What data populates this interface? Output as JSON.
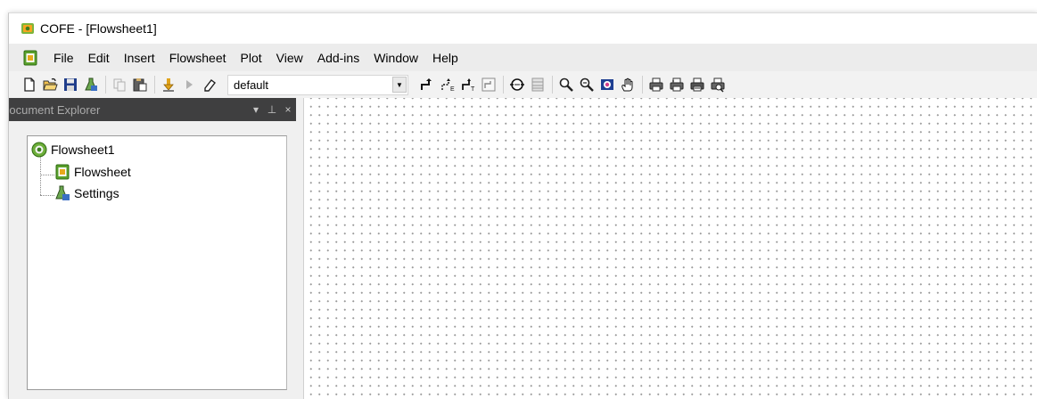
{
  "window": {
    "title": "COFE - [Flowsheet1]",
    "app_icon": "cofe-app-icon"
  },
  "menu": {
    "items": [
      "File",
      "Edit",
      "Insert",
      "Flowsheet",
      "Plot",
      "View",
      "Add-ins",
      "Window",
      "Help"
    ]
  },
  "toolbar": {
    "combo_value": "default",
    "buttons": [
      "new-icon",
      "open-icon",
      "save-icon",
      "flask-icon",
      "copy-icon",
      "paste-icon",
      "download-icon",
      "play-icon",
      "eraser-icon",
      "stream-icon",
      "stream-split-icon",
      "stream-merge-icon",
      "stream-box-icon",
      "unit-op-icon",
      "grid-icon",
      "zoom-in-icon",
      "zoom-out-icon",
      "zoom-window-icon",
      "pan-icon",
      "print-icon",
      "print-preview-icon",
      "print-setup-icon",
      "print-all-icon"
    ]
  },
  "explorer": {
    "title": "Document Explorer",
    "controls": {
      "dropdown": "▾",
      "pin": "⊥",
      "close": "×"
    },
    "tree": {
      "root": "Flowsheet1",
      "children": [
        "Flowsheet",
        "Settings"
      ]
    }
  },
  "colors": {
    "panel_header": "#3f3f40",
    "menubar": "#ececec",
    "canvas_dot": "#9a9a9a"
  }
}
